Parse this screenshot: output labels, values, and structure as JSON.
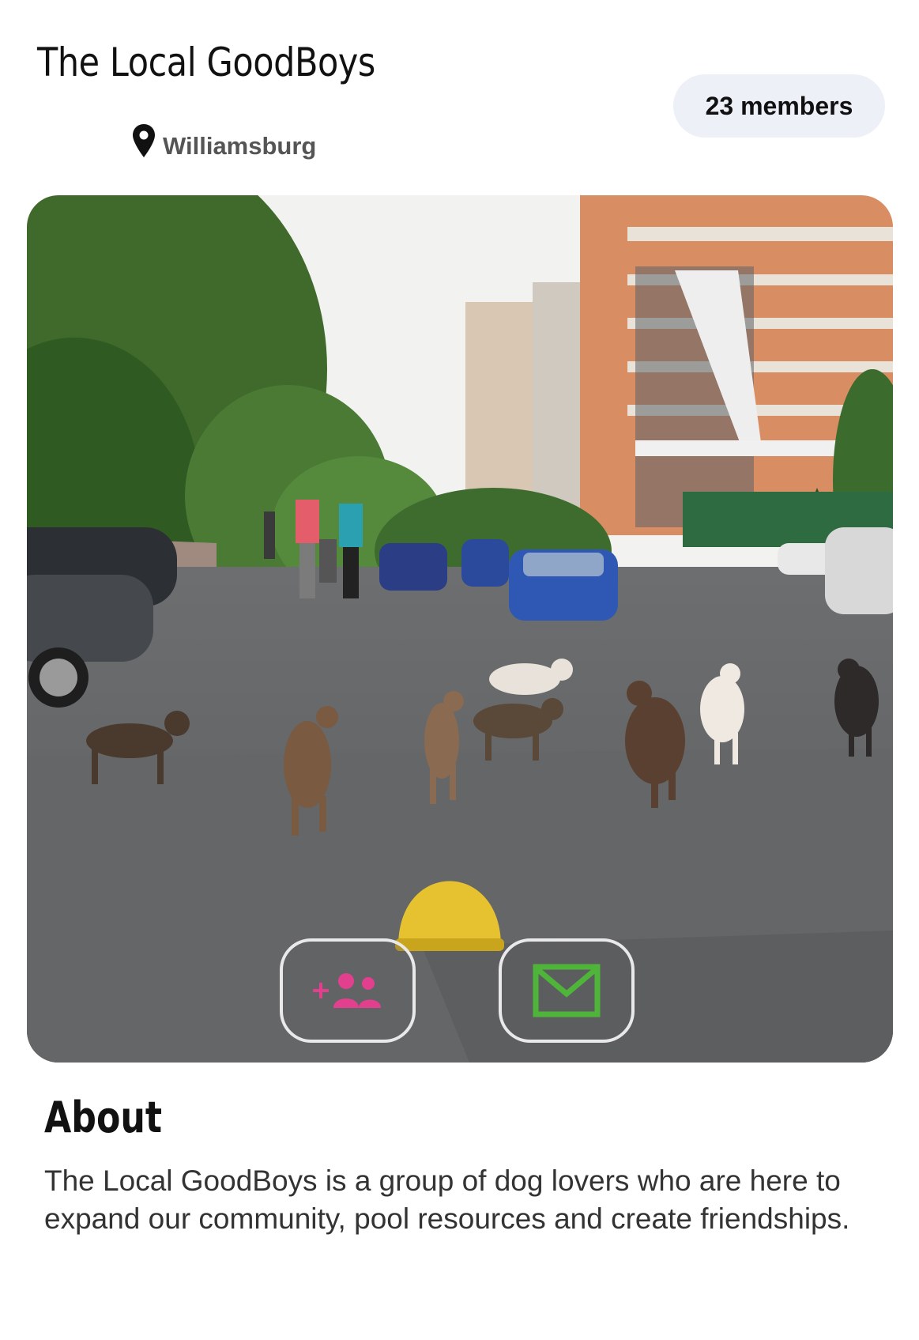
{
  "group": {
    "title": "The Local GoodBoys",
    "members_label": "23 members",
    "location": "Williamsburg"
  },
  "actions": {
    "join_icon": "add-group-icon",
    "message_icon": "envelope-icon"
  },
  "colors": {
    "join_accent": "#e33f8f",
    "message_accent": "#4fb53a",
    "members_badge_bg": "#eef0f8"
  },
  "about": {
    "heading": "About",
    "text": "The Local GoodBoys is a group of dog lovers who are here to expand our community, pool resources and create friendships."
  }
}
